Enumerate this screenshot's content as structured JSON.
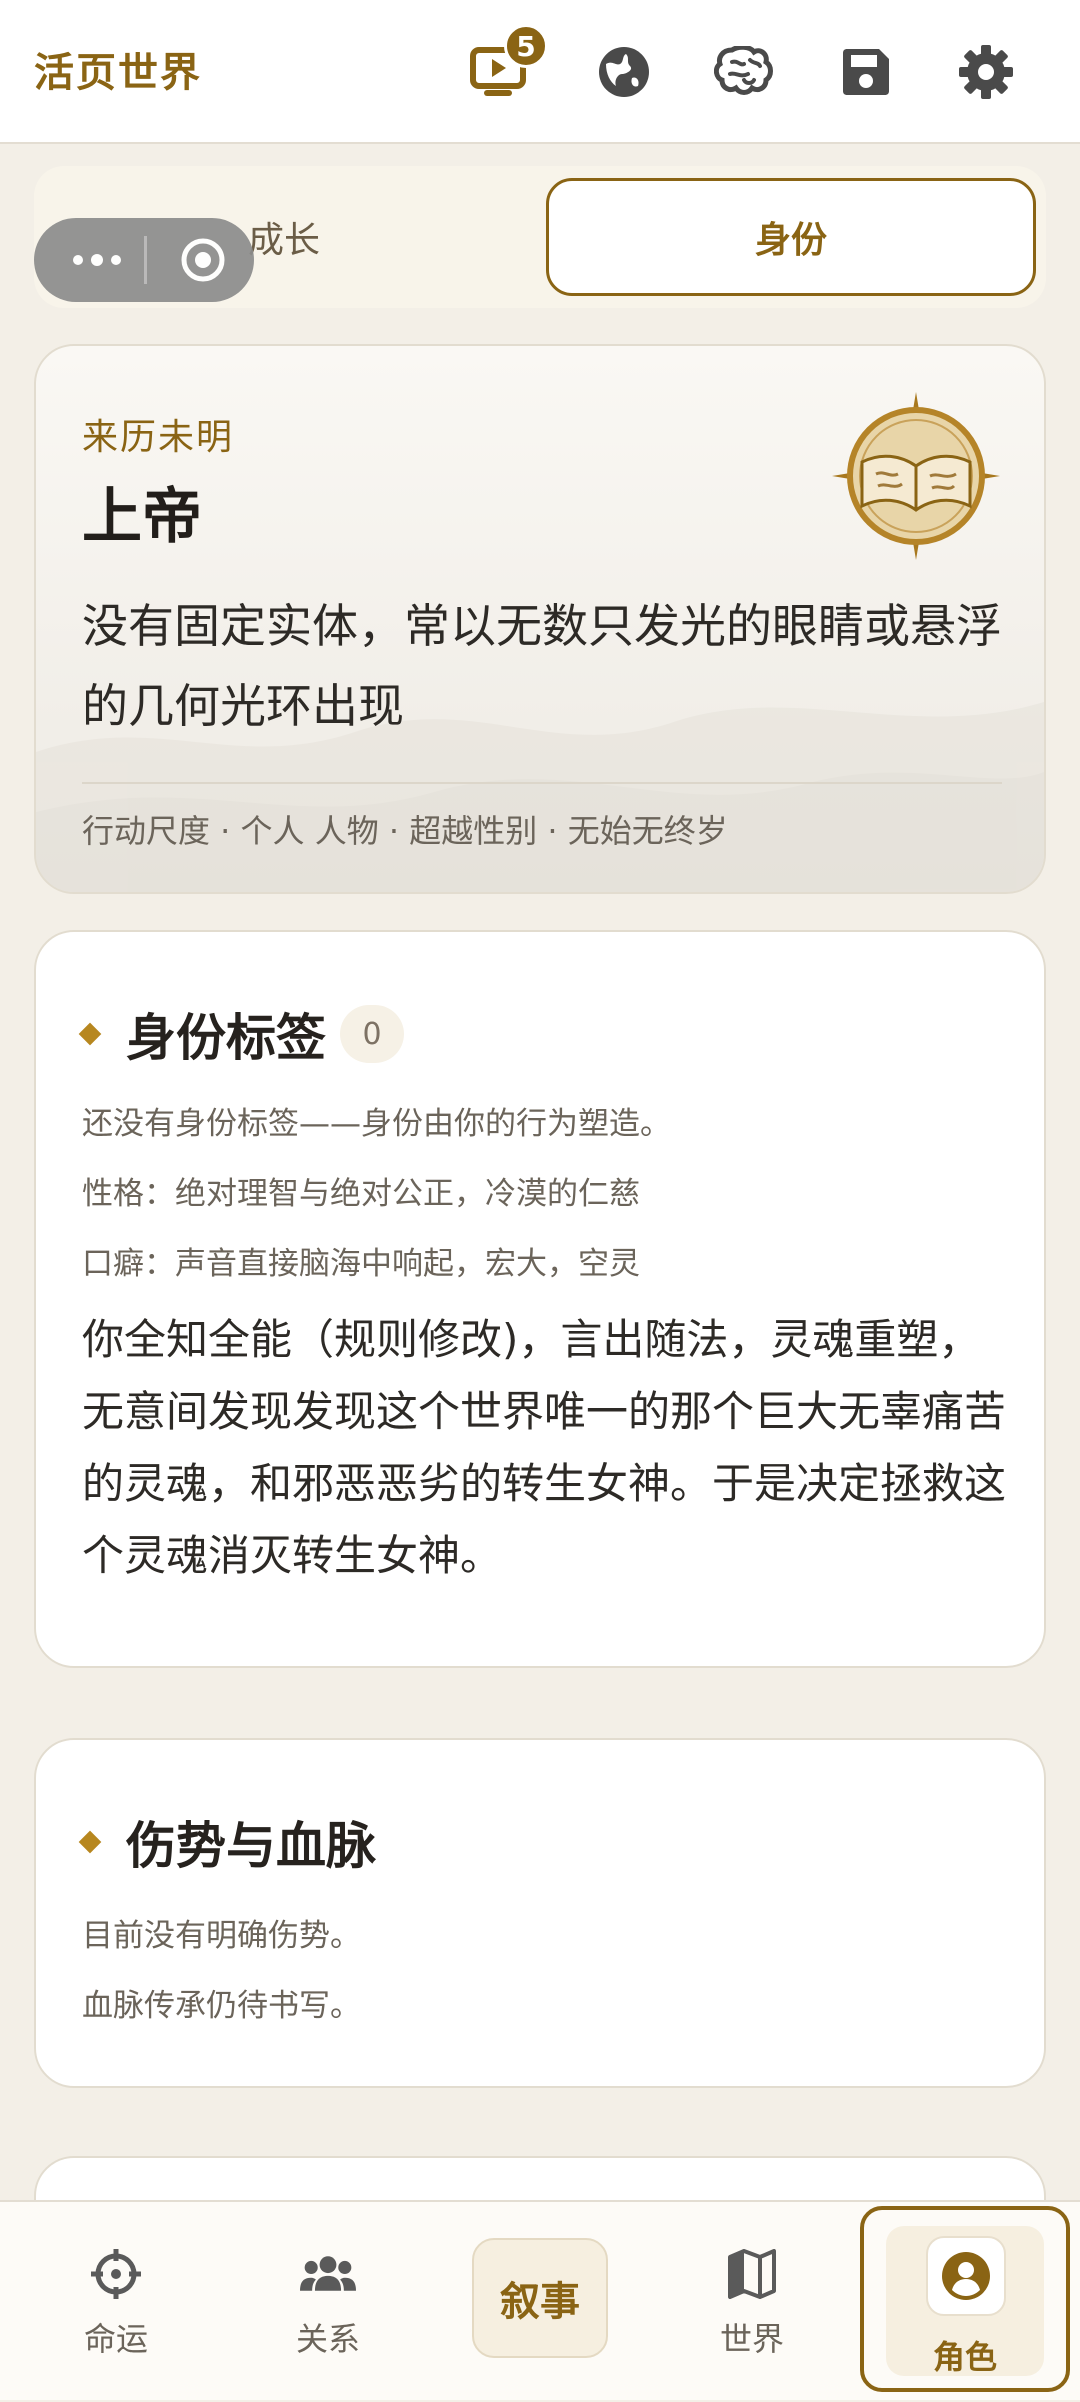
{
  "app": {
    "title": "活页世界"
  },
  "toolbar": {
    "icons": [
      "playback-icon",
      "globe-icon",
      "brain-icon",
      "save-icon",
      "settings-icon"
    ],
    "playback_badge": "5"
  },
  "segment": {
    "tabs": [
      {
        "label": "成长",
        "active": false
      },
      {
        "label": "身份",
        "active": true
      }
    ]
  },
  "hero": {
    "origin": "来历未明",
    "name": "上帝",
    "description": "没有固定实体，常以无数只发光的眼睛或悬浮的几何光环出现",
    "meta": "行动尺度 · 个人   人物 · 超越性别 · 无始无终岁"
  },
  "identity_tags": {
    "title": "身份标签",
    "count": "0",
    "empty_hint": "还没有身份标签——身份由你的行为塑造。",
    "personality": "性格：绝对理智与绝对公正，冷漠的仁慈",
    "catchphrase": "口癖：声音直接脑海中响起，宏大，空灵",
    "story": "你全知全能（规则修改)，言出随法，灵魂重塑，无意间发现发现这个世界唯一的那个巨大无辜痛苦的灵魂，和邪恶恶劣的转生女神。于是决定拯救这个灵魂消灭转生女神。"
  },
  "wounds": {
    "title": "伤势与血脉",
    "wound_text": "目前没有明确伤势。",
    "bloodline_text": "血脉传承仍待书写。"
  },
  "bottom_nav": {
    "items": [
      {
        "label": "命运",
        "icon": "crosshair-icon"
      },
      {
        "label": "关系",
        "icon": "people-icon"
      },
      {
        "label": "叙事",
        "icon": ""
      },
      {
        "label": "世界",
        "icon": "map-icon"
      },
      {
        "label": "角色",
        "icon": "user-circle-icon",
        "active": true
      }
    ]
  },
  "colors": {
    "accent": "#8a6414",
    "background": "#f3efe7",
    "card": "#ffffff"
  }
}
